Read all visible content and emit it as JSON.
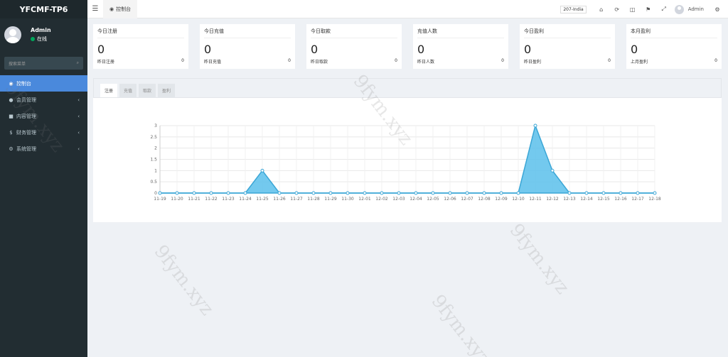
{
  "sidebar": {
    "logo": "YFCMF-TP6",
    "user_name": "Admin",
    "user_status": "在线",
    "search_placeholder": "搜索菜单",
    "items": [
      {
        "label": "控制台",
        "icon": "dashboard-icon"
      },
      {
        "label": "会员管理",
        "icon": "user-icon"
      },
      {
        "label": "内容管理",
        "icon": "file-icon"
      },
      {
        "label": "财务管理",
        "icon": "dollar-icon"
      },
      {
        "label": "系统管理",
        "icon": "gears-icon"
      }
    ]
  },
  "header": {
    "tab_label": "控制台",
    "lang": "207-India",
    "user_name": "Admin"
  },
  "cards": [
    {
      "title": "今日注册",
      "value": "0",
      "foot_label": "昨日注册",
      "foot_value": "0"
    },
    {
      "title": "今日充值",
      "value": "0",
      "foot_label": "昨日充值",
      "foot_value": "0"
    },
    {
      "title": "今日取款",
      "value": "0",
      "foot_label": "昨日取款",
      "foot_value": "0"
    },
    {
      "title": "充值人数",
      "value": "0",
      "foot_label": "昨日人数",
      "foot_value": "0"
    },
    {
      "title": "今日盈利",
      "value": "0",
      "foot_label": "昨日盈利",
      "foot_value": "0"
    },
    {
      "title": "本月盈利",
      "value": "0",
      "foot_label": "上月盈利",
      "foot_value": "0"
    }
  ],
  "chart_tabs": [
    "注册",
    "充值",
    "取款",
    "盈利"
  ],
  "chart_data": {
    "type": "area",
    "categories": [
      "11-19",
      "11-20",
      "11-21",
      "11-22",
      "11-23",
      "11-24",
      "11-25",
      "11-26",
      "11-27",
      "11-28",
      "11-29",
      "11-30",
      "12-01",
      "12-02",
      "12-03",
      "12-04",
      "12-05",
      "12-06",
      "12-07",
      "12-08",
      "12-09",
      "12-10",
      "12-11",
      "12-12",
      "12-13",
      "12-14",
      "12-15",
      "12-16",
      "12-17",
      "12-18"
    ],
    "values": [
      0,
      0,
      0,
      0,
      0,
      0,
      1,
      0,
      0,
      0,
      0,
      0,
      0,
      0,
      0,
      0,
      0,
      0,
      0,
      0,
      0,
      0,
      3,
      1,
      0,
      0,
      0,
      0,
      0,
      0
    ],
    "yticks": [
      "0",
      "0.5",
      "1",
      "1.5",
      "2",
      "2.5",
      "3"
    ],
    "ylim": [
      0,
      3
    ],
    "grid": true,
    "color": "#5bc0eb"
  },
  "watermark": "9fym.xyz"
}
